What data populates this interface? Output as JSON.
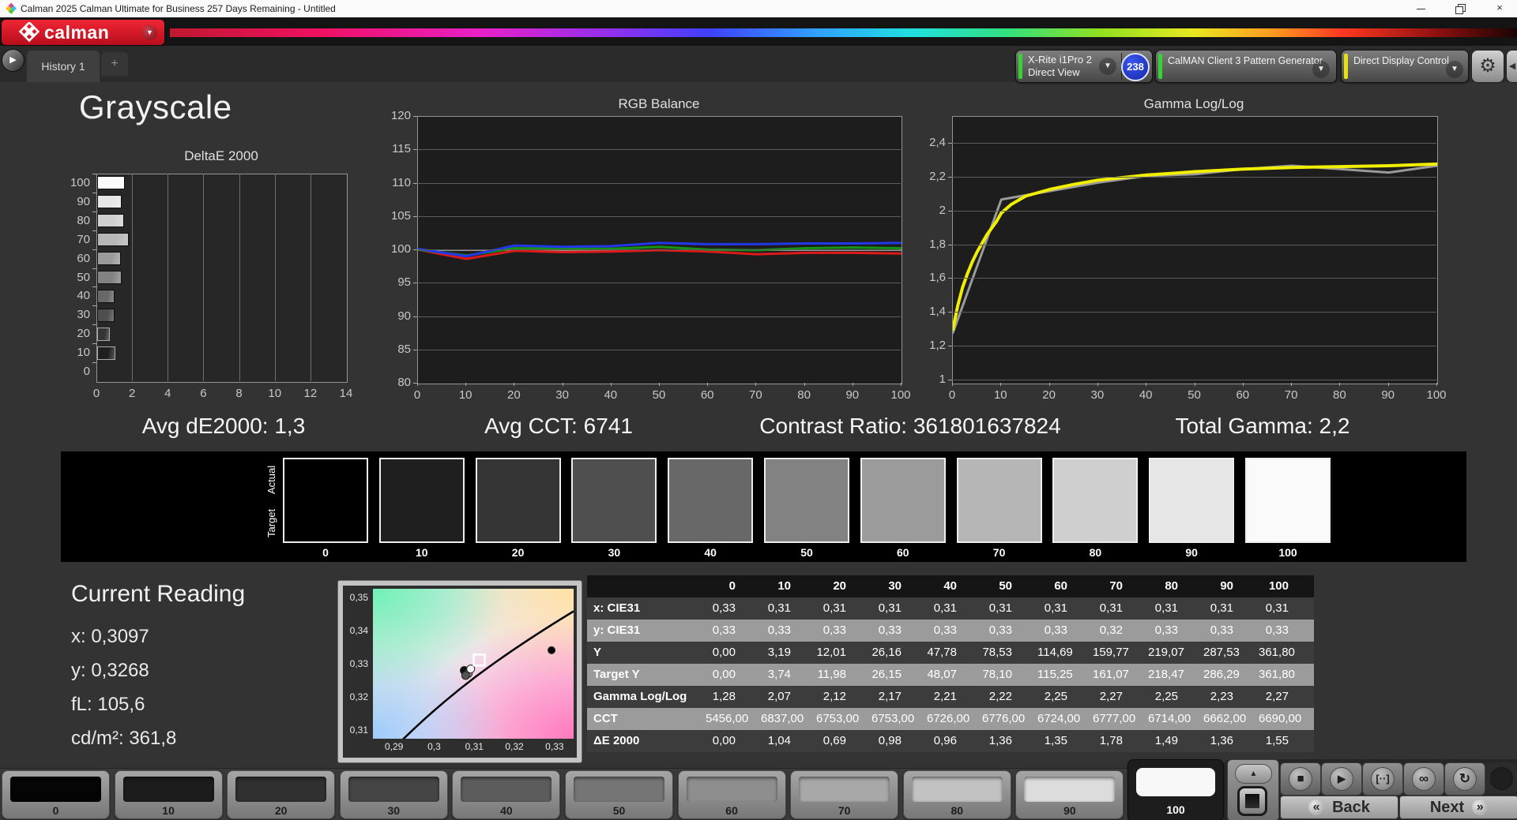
{
  "window": {
    "title": "Calman 2025 Calman Ultimate for Business 257 Days Remaining - Untitled"
  },
  "brand": {
    "logo_text": "calman"
  },
  "tabs": {
    "history_tab": "History 1",
    "add_tab": "+"
  },
  "toolbar": {
    "meter": {
      "line1": "X-Rite i1Pro 2",
      "line2": "Direct View",
      "badge": "238",
      "accent": "#35d435"
    },
    "pattern_generator": {
      "label": "CalMAN Client 3 Pattern Generator",
      "accent": "#35d435"
    },
    "display_control": {
      "label": "Direct Display Control",
      "accent": "#e8e012"
    },
    "gear": "⚙"
  },
  "page": {
    "title": "Grayscale"
  },
  "stats": [
    {
      "label": "Avg dE2000: 1,3"
    },
    {
      "label": "Avg CCT: 6741"
    },
    {
      "label": "Contrast Ratio: 361801637824"
    },
    {
      "label": "Total Gamma: 2,2"
    }
  ],
  "swatch_strip": {
    "row_labels": [
      "Actual",
      "Target"
    ],
    "levels": [
      "0",
      "10",
      "20",
      "30",
      "40",
      "50",
      "60",
      "70",
      "80",
      "90",
      "100"
    ],
    "colors": [
      "#000000",
      "#1f1f1f",
      "#353535",
      "#4f4f4f",
      "#686868",
      "#828282",
      "#9b9b9b",
      "#b6b6b6",
      "#cfcfcf",
      "#e6e6e6",
      "#fafafa"
    ]
  },
  "current_reading": {
    "title": "Current Reading",
    "lines": [
      "x: 0,3097",
      "y: 0,3268",
      "fL: 105,6",
      "cd/m²: 361,8"
    ]
  },
  "table": {
    "columns": [
      "0",
      "10",
      "20",
      "30",
      "40",
      "50",
      "60",
      "70",
      "80",
      "90",
      "100"
    ],
    "rows": [
      {
        "label": "x: CIE31",
        "values": [
          "0,33",
          "0,31",
          "0,31",
          "0,31",
          "0,31",
          "0,31",
          "0,31",
          "0,31",
          "0,31",
          "0,31",
          "0,31"
        ]
      },
      {
        "label": "y: CIE31",
        "values": [
          "0,33",
          "0,33",
          "0,33",
          "0,33",
          "0,33",
          "0,33",
          "0,33",
          "0,32",
          "0,33",
          "0,33",
          "0,33"
        ]
      },
      {
        "label": "Y",
        "values": [
          "0,00",
          "3,19",
          "12,01",
          "26,16",
          "47,78",
          "78,53",
          "114,69",
          "159,77",
          "219,07",
          "287,53",
          "361,80"
        ]
      },
      {
        "label": "Target Y",
        "values": [
          "0,00",
          "3,74",
          "11,98",
          "26,15",
          "48,07",
          "78,10",
          "115,25",
          "161,07",
          "218,47",
          "286,29",
          "361,80"
        ]
      },
      {
        "label": "Gamma Log/Log",
        "values": [
          "1,28",
          "2,07",
          "2,12",
          "2,17",
          "2,21",
          "2,22",
          "2,25",
          "2,27",
          "2,25",
          "2,23",
          "2,27"
        ]
      },
      {
        "label": "CCT",
        "values": [
          "5456,00",
          "6837,00",
          "6753,00",
          "6753,00",
          "6726,00",
          "6776,00",
          "6724,00",
          "6777,00",
          "6714,00",
          "6662,00",
          "6690,00"
        ]
      },
      {
        "label": "ΔE 2000",
        "values": [
          "0,00",
          "1,04",
          "0,69",
          "0,98",
          "0,96",
          "1,36",
          "1,35",
          "1,78",
          "1,49",
          "1,36",
          "1,55"
        ]
      }
    ]
  },
  "bottom_bar": {
    "tiles": [
      "0",
      "10",
      "20",
      "30",
      "40",
      "50",
      "60",
      "70",
      "80",
      "90",
      "100"
    ],
    "tile_colors": [
      "#050505",
      "#1c1c1c",
      "#303030",
      "#454545",
      "#5c5c5c",
      "#757575",
      "#8e8e8e",
      "#a8a8a8",
      "#c2c2c2",
      "#dcdcdc",
      "#f8f8f8"
    ],
    "selected_tile": "100",
    "transport": [
      "■",
      "▶",
      "[··]",
      "∞",
      "↻"
    ],
    "back_label": "Back",
    "next_label": "Next"
  },
  "chart_data": [
    {
      "id": "deltae",
      "type": "bar",
      "title": "DeltaE 2000",
      "orientation": "horizontal",
      "categories": [
        100,
        90,
        80,
        70,
        60,
        50,
        40,
        30,
        20,
        10,
        0
      ],
      "values": [
        1.55,
        1.36,
        1.49,
        1.78,
        1.35,
        1.36,
        0.96,
        0.98,
        0.69,
        1.04,
        0
      ],
      "bar_colors": [
        "#fafafa",
        "#e6e6e6",
        "#cfcfcf",
        "#b6b6b6",
        "#9b9b9b",
        "#828282",
        "#686868",
        "#4f4f4f",
        "#353535",
        "#1f1f1f",
        "#000000"
      ],
      "xlim": [
        0,
        14
      ],
      "xticks": [
        0,
        2,
        4,
        6,
        8,
        10,
        12,
        14
      ],
      "grid": "vertical"
    },
    {
      "id": "rgb_balance",
      "type": "line",
      "title": "RGB Balance",
      "x": [
        0,
        10,
        20,
        30,
        40,
        50,
        60,
        70,
        80,
        90,
        100
      ],
      "series": [
        {
          "name": "red",
          "color": "#dd1a1a",
          "values": [
            100.1,
            98.7,
            99.9,
            99.7,
            99.8,
            100.0,
            99.8,
            99.4,
            99.6,
            99.6,
            99.5
          ]
        },
        {
          "name": "green",
          "color": "#169416",
          "values": [
            100.1,
            99.2,
            100.3,
            100.2,
            100.2,
            100.5,
            100.1,
            100.0,
            100.3,
            100.4,
            100.3
          ]
        },
        {
          "name": "blue",
          "color": "#2238e8",
          "values": [
            100.2,
            99.1,
            100.7,
            100.5,
            100.6,
            101.1,
            100.9,
            100.9,
            101.0,
            101.0,
            101.1
          ]
        }
      ],
      "reference_line": 100,
      "ylim": [
        80,
        120
      ],
      "yticks": [
        80,
        85,
        90,
        95,
        100,
        105,
        110,
        115,
        120
      ],
      "xticks": [
        0,
        10,
        20,
        30,
        40,
        50,
        60,
        70,
        80,
        90,
        100
      ]
    },
    {
      "id": "gamma",
      "type": "line",
      "title": "Gamma Log/Log",
      "series": [
        {
          "name": "measured",
          "color": "#9a9a9a",
          "x": [
            0,
            10,
            20,
            30,
            40,
            50,
            60,
            70,
            80,
            90,
            100
          ],
          "values": [
            1.28,
            2.07,
            2.12,
            2.17,
            2.21,
            2.22,
            2.25,
            2.27,
            2.25,
            2.23,
            2.27
          ]
        },
        {
          "name": "target",
          "color": "#f2ee00",
          "x": [
            0,
            1,
            2,
            3,
            4,
            5,
            6,
            7,
            8,
            9,
            10,
            12,
            15,
            20,
            25,
            30,
            35,
            40,
            45,
            50,
            60,
            70,
            80,
            90,
            100
          ],
          "values": [
            1.3,
            1.44,
            1.55,
            1.63,
            1.7,
            1.76,
            1.81,
            1.86,
            1.9,
            1.94,
            1.99,
            2.04,
            2.09,
            2.13,
            2.16,
            2.185,
            2.2,
            2.215,
            2.225,
            2.235,
            2.25,
            2.26,
            2.265,
            2.27,
            2.28
          ]
        }
      ],
      "ylim": [
        0.98,
        2.56
      ],
      "yticks": [
        1,
        1.2,
        1.4,
        1.6,
        1.8,
        2,
        2.2,
        2.4
      ],
      "ytick_labels": [
        "1",
        "1,2",
        "1,4",
        "1,6",
        "1,8",
        "2",
        "2,2",
        "2,4"
      ],
      "xticks": [
        0,
        10,
        20,
        30,
        40,
        50,
        60,
        70,
        80,
        90,
        100
      ]
    },
    {
      "id": "cie_xy",
      "type": "scatter",
      "xtick_labels": [
        "0,29",
        "0,3",
        "0,31",
        "0,32",
        "0,33"
      ],
      "ytick_labels": [
        "0,35",
        "0,34",
        "0,33",
        "0,32",
        "0,31"
      ],
      "points": [
        {
          "name": "measured-point",
          "fx": 0.455,
          "fy": 0.545,
          "color": "#111111"
        },
        {
          "name": "measured-point",
          "fx": 0.475,
          "fy": 0.565,
          "color": "#8a8a8a"
        },
        {
          "name": "measured-point",
          "fx": 0.462,
          "fy": 0.578,
          "color": "#555555"
        },
        {
          "name": "measured-point",
          "fx": 0.487,
          "fy": 0.535,
          "color": "#f5f5f5"
        },
        {
          "name": "white-point",
          "fx": 0.89,
          "fy": 0.41,
          "color": "#000000"
        }
      ],
      "target_square": {
        "fx": 0.53,
        "fy": 0.475
      }
    }
  ]
}
